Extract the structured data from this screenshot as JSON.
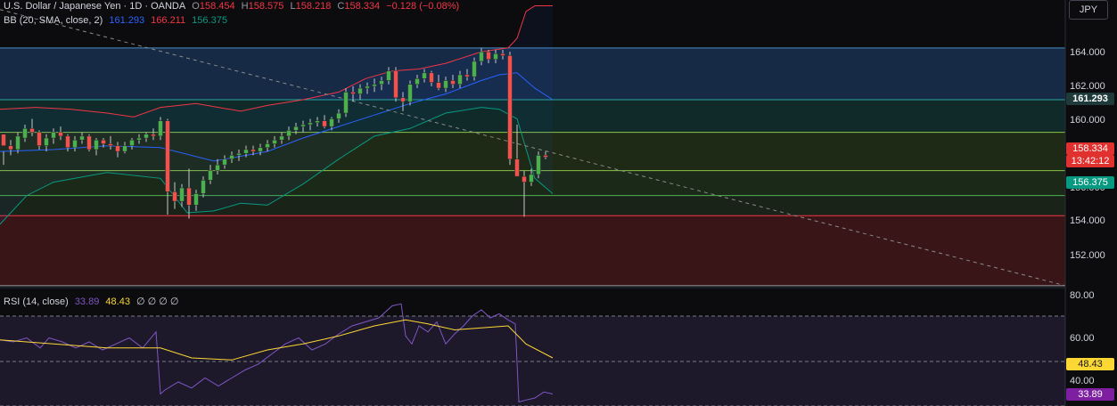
{
  "header": {
    "symbol": "U.S. Dollar / Japanese Yen · 1D · OANDA",
    "o_label": "O",
    "o_value": "158.454",
    "h_label": "H",
    "h_value": "158.575",
    "l_label": "L",
    "l_value": "158.218",
    "c_label": "C",
    "c_value": "158.334",
    "change": "−0.128 (−0.08%)",
    "bb_label": "BB (20, SMA, close, 2)",
    "bb_basis": "161.293",
    "bb_upper": "166.211",
    "bb_lower": "156.375",
    "rsi_label": "RSI (14, close)",
    "rsi_value": "33.89",
    "rsi_ma": "48.43",
    "rsi_extra": "∅ ∅ ∅ ∅"
  },
  "currency_button": "JPY",
  "price_axis": {
    "ticks": [
      "164.000",
      "162.000",
      "160.000",
      "156.000",
      "154.000",
      "152.000"
    ]
  },
  "rsi_axis": {
    "ticks": [
      "80.00",
      "60.00",
      "40.00"
    ]
  },
  "tags": {
    "basis": "161.293",
    "last_price": "158.334",
    "countdown": "13:42:12",
    "lower_band": "156.375",
    "rsi_ma": "48.43",
    "rsi": "33.89"
  },
  "colors": {
    "up": "#26a69a",
    "down": "#ef5350",
    "basis": "#2962ff",
    "upper": "#f23645",
    "lower": "#089981",
    "rsi": "#7e57c2",
    "rsi_ma": "#fdd835"
  },
  "chart_data": {
    "type": "candlestick",
    "price_range": [
      151.5,
      166.5
    ],
    "rsi_range": [
      26,
      82
    ],
    "candles": [
      [
        159.5,
        158.6,
        157.9,
        158.9
      ],
      [
        158.9,
        159.2,
        158.4,
        158.7
      ],
      [
        158.7,
        159.6,
        158.5,
        159.4
      ],
      [
        159.3,
        160.0,
        159.1,
        159.8
      ],
      [
        159.8,
        160.3,
        159.4,
        159.6
      ],
      [
        159.6,
        159.7,
        158.7,
        158.9
      ],
      [
        158.9,
        159.5,
        158.6,
        159.3
      ],
      [
        159.3,
        159.8,
        159.0,
        159.6
      ],
      [
        159.6,
        159.9,
        159.2,
        159.4
      ],
      [
        159.4,
        159.5,
        158.6,
        158.8
      ],
      [
        158.8,
        159.4,
        158.6,
        159.2
      ],
      [
        159.2,
        159.6,
        159.0,
        159.4
      ],
      [
        159.4,
        159.5,
        158.6,
        158.7
      ],
      [
        158.7,
        159.3,
        158.4,
        159.2
      ],
      [
        159.2,
        159.3,
        158.8,
        159.0
      ],
      [
        159.0,
        159.4,
        158.7,
        158.9
      ],
      [
        158.9,
        159.1,
        158.3,
        158.6
      ],
      [
        158.6,
        159.1,
        158.5,
        158.9
      ],
      [
        158.9,
        159.3,
        158.7,
        159.2
      ],
      [
        159.2,
        159.5,
        159.0,
        159.3
      ],
      [
        159.3,
        159.6,
        159.1,
        159.5
      ],
      [
        159.5,
        159.8,
        159.2,
        159.4
      ],
      [
        159.4,
        160.4,
        159.2,
        160.2
      ],
      [
        160.2,
        160.3,
        155.3,
        156.5
      ],
      [
        156.5,
        157.0,
        155.6,
        156.0
      ],
      [
        156.0,
        156.9,
        155.7,
        156.7
      ],
      [
        156.7,
        157.7,
        155.1,
        155.8
      ],
      [
        155.8,
        156.6,
        155.5,
        156.4
      ],
      [
        156.4,
        157.3,
        156.2,
        157.1
      ],
      [
        157.1,
        157.9,
        156.9,
        157.6
      ],
      [
        157.6,
        158.2,
        157.4,
        157.9
      ],
      [
        157.9,
        158.4,
        157.7,
        158.2
      ],
      [
        158.2,
        158.6,
        158.0,
        158.4
      ],
      [
        158.4,
        158.7,
        158.1,
        158.5
      ],
      [
        158.5,
        158.9,
        158.3,
        158.7
      ],
      [
        158.7,
        158.9,
        158.4,
        158.6
      ],
      [
        158.6,
        159.0,
        158.4,
        158.8
      ],
      [
        158.8,
        159.2,
        158.6,
        159.0
      ],
      [
        159.0,
        159.4,
        158.8,
        159.2
      ],
      [
        159.2,
        159.6,
        159.0,
        159.4
      ],
      [
        159.4,
        159.9,
        159.2,
        159.7
      ],
      [
        159.7,
        160.1,
        159.5,
        159.9
      ],
      [
        159.9,
        160.2,
        159.6,
        160.0
      ],
      [
        160.0,
        160.3,
        159.7,
        160.1
      ],
      [
        160.1,
        160.4,
        159.9,
        160.2
      ],
      [
        160.2,
        160.5,
        159.8,
        159.9
      ],
      [
        159.9,
        160.4,
        159.7,
        160.3
      ],
      [
        160.3,
        160.8,
        160.1,
        160.6
      ],
      [
        160.6,
        161.9,
        160.4,
        161.7
      ],
      [
        161.7,
        162.0,
        161.2,
        161.6
      ],
      [
        161.6,
        162.1,
        161.3,
        161.9
      ],
      [
        161.9,
        162.2,
        161.6,
        162.0
      ],
      [
        162.0,
        162.4,
        161.7,
        162.1
      ],
      [
        162.1,
        162.5,
        161.8,
        162.3
      ],
      [
        162.3,
        163.0,
        162.1,
        162.8
      ],
      [
        162.8,
        163.0,
        161.2,
        161.4
      ],
      [
        161.4,
        161.7,
        160.7,
        161.2
      ],
      [
        161.2,
        162.3,
        161.0,
        162.1
      ],
      [
        162.1,
        162.6,
        161.9,
        162.4
      ],
      [
        162.4,
        162.9,
        162.2,
        162.7
      ],
      [
        162.7,
        162.8,
        162.0,
        162.2
      ],
      [
        162.2,
        162.6,
        161.8,
        161.9
      ],
      [
        161.9,
        162.5,
        161.7,
        162.3
      ],
      [
        162.3,
        162.6,
        161.9,
        162.1
      ],
      [
        162.1,
        162.8,
        161.9,
        162.6
      ],
      [
        162.6,
        162.9,
        162.3,
        162.5
      ],
      [
        162.5,
        163.5,
        162.3,
        163.3
      ],
      [
        163.3,
        164.0,
        163.1,
        163.8
      ],
      [
        163.8,
        163.9,
        163.2,
        163.4
      ],
      [
        163.4,
        163.9,
        163.2,
        163.7
      ],
      [
        163.7,
        163.9,
        163.4,
        163.6
      ],
      [
        163.6,
        163.8,
        157.9,
        158.2
      ],
      [
        158.2,
        160.0,
        157.5,
        157.3
      ],
      [
        157.3,
        157.6,
        155.2,
        157.0
      ],
      [
        157.0,
        157.7,
        156.8,
        157.4
      ],
      [
        157.4,
        158.6,
        157.2,
        158.4
      ],
      [
        158.4,
        158.6,
        158.2,
        158.3
      ]
    ],
    "bb_upper_x": [
      0,
      40,
      80,
      120,
      150,
      180,
      220,
      270,
      300,
      340,
      380,
      410,
      440,
      470,
      500,
      540,
      570,
      580,
      590,
      600,
      620
    ],
    "bb_upper_y": [
      160.8,
      160.9,
      160.8,
      160.6,
      160.4,
      160.9,
      161.1,
      160.7,
      161.0,
      161.3,
      161.7,
      162.4,
      162.8,
      162.9,
      163.2,
      163.8,
      164.0,
      164.5,
      165.9,
      166.2,
      166.2
    ],
    "bb_basis_x": [
      0,
      60,
      120,
      180,
      240,
      300,
      340,
      380,
      420,
      460,
      500,
      540,
      560,
      580,
      600,
      620
    ],
    "bb_basis_y": [
      158.6,
      158.7,
      158.9,
      158.8,
      158.1,
      158.6,
      159.3,
      159.9,
      160.5,
      161.1,
      161.6,
      162.3,
      162.6,
      162.7,
      161.9,
      161.3
    ],
    "bb_lower_x": [
      0,
      30,
      60,
      120,
      180,
      210,
      240,
      270,
      300,
      340,
      380,
      420,
      460,
      500,
      540,
      560,
      580,
      600,
      620
    ],
    "bb_lower_y": [
      154.8,
      156.3,
      157.0,
      157.5,
      157.2,
      155.4,
      155.5,
      155.9,
      155.8,
      156.9,
      158.2,
      159.4,
      159.8,
      160.6,
      160.9,
      160.8,
      160.3,
      157.2,
      156.4
    ],
    "trend_x": [
      0,
      1195
    ],
    "trend_y": [
      166.0,
      151.6
    ],
    "hlines": [
      {
        "y": 164.0,
        "color": "#4a90c2"
      },
      {
        "y": 161.3,
        "color": "#26a69a"
      },
      {
        "y": 159.6,
        "color": "#8bc34a"
      },
      {
        "y": 157.6,
        "color": "#8bc34a"
      },
      {
        "y": 156.3,
        "color": "#4caf50"
      },
      {
        "y": 155.25,
        "color": "#f23645"
      },
      {
        "y": 151.6,
        "color": "#9e9e9e"
      }
    ],
    "zones": [
      {
        "from": 164.0,
        "to": 161.3,
        "color": "#162a45"
      },
      {
        "from": 161.3,
        "to": 159.6,
        "color": "#0f2a28"
      },
      {
        "from": 159.6,
        "to": 157.6,
        "color": "#1e2a16"
      },
      {
        "from": 157.6,
        "to": 156.3,
        "color": "#1b2a18"
      },
      {
        "from": 156.3,
        "to": 155.25,
        "color": "#1a2318"
      },
      {
        "from": 155.25,
        "to": 151.6,
        "color": "#3a1518"
      }
    ],
    "rsi_x": [
      0,
      15,
      30,
      45,
      55,
      70,
      85,
      100,
      115,
      130,
      145,
      160,
      175,
      180,
      185,
      200,
      215,
      230,
      245,
      260,
      275,
      290,
      305,
      320,
      335,
      350,
      365,
      380,
      395,
      410,
      425,
      440,
      450,
      455,
      462,
      470,
      480,
      490,
      500,
      510,
      520,
      530,
      540,
      550,
      560,
      570,
      578,
      582,
      590,
      600,
      610,
      620
    ],
    "rsi_y": [
      59,
      58,
      60,
      55,
      60,
      58,
      55,
      58,
      54,
      57,
      60,
      55,
      63,
      32,
      34,
      38,
      35,
      40,
      36,
      40,
      44,
      47,
      52,
      57,
      60,
      54,
      57,
      62,
      66,
      68,
      70,
      76,
      77,
      61,
      57,
      66,
      63,
      68,
      57,
      62,
      66,
      71,
      74,
      70,
      72,
      69,
      67,
      28,
      29,
      30,
      33,
      32
    ],
    "rsi_ma_x": [
      0,
      60,
      120,
      180,
      215,
      260,
      300,
      340,
      380,
      420,
      455,
      480,
      510,
      540,
      570,
      590,
      620
    ],
    "rsi_ma_y": [
      59,
      57,
      55,
      55,
      50,
      49,
      54,
      57,
      61,
      66,
      69,
      67,
      64,
      65,
      66,
      57,
      50
    ]
  }
}
